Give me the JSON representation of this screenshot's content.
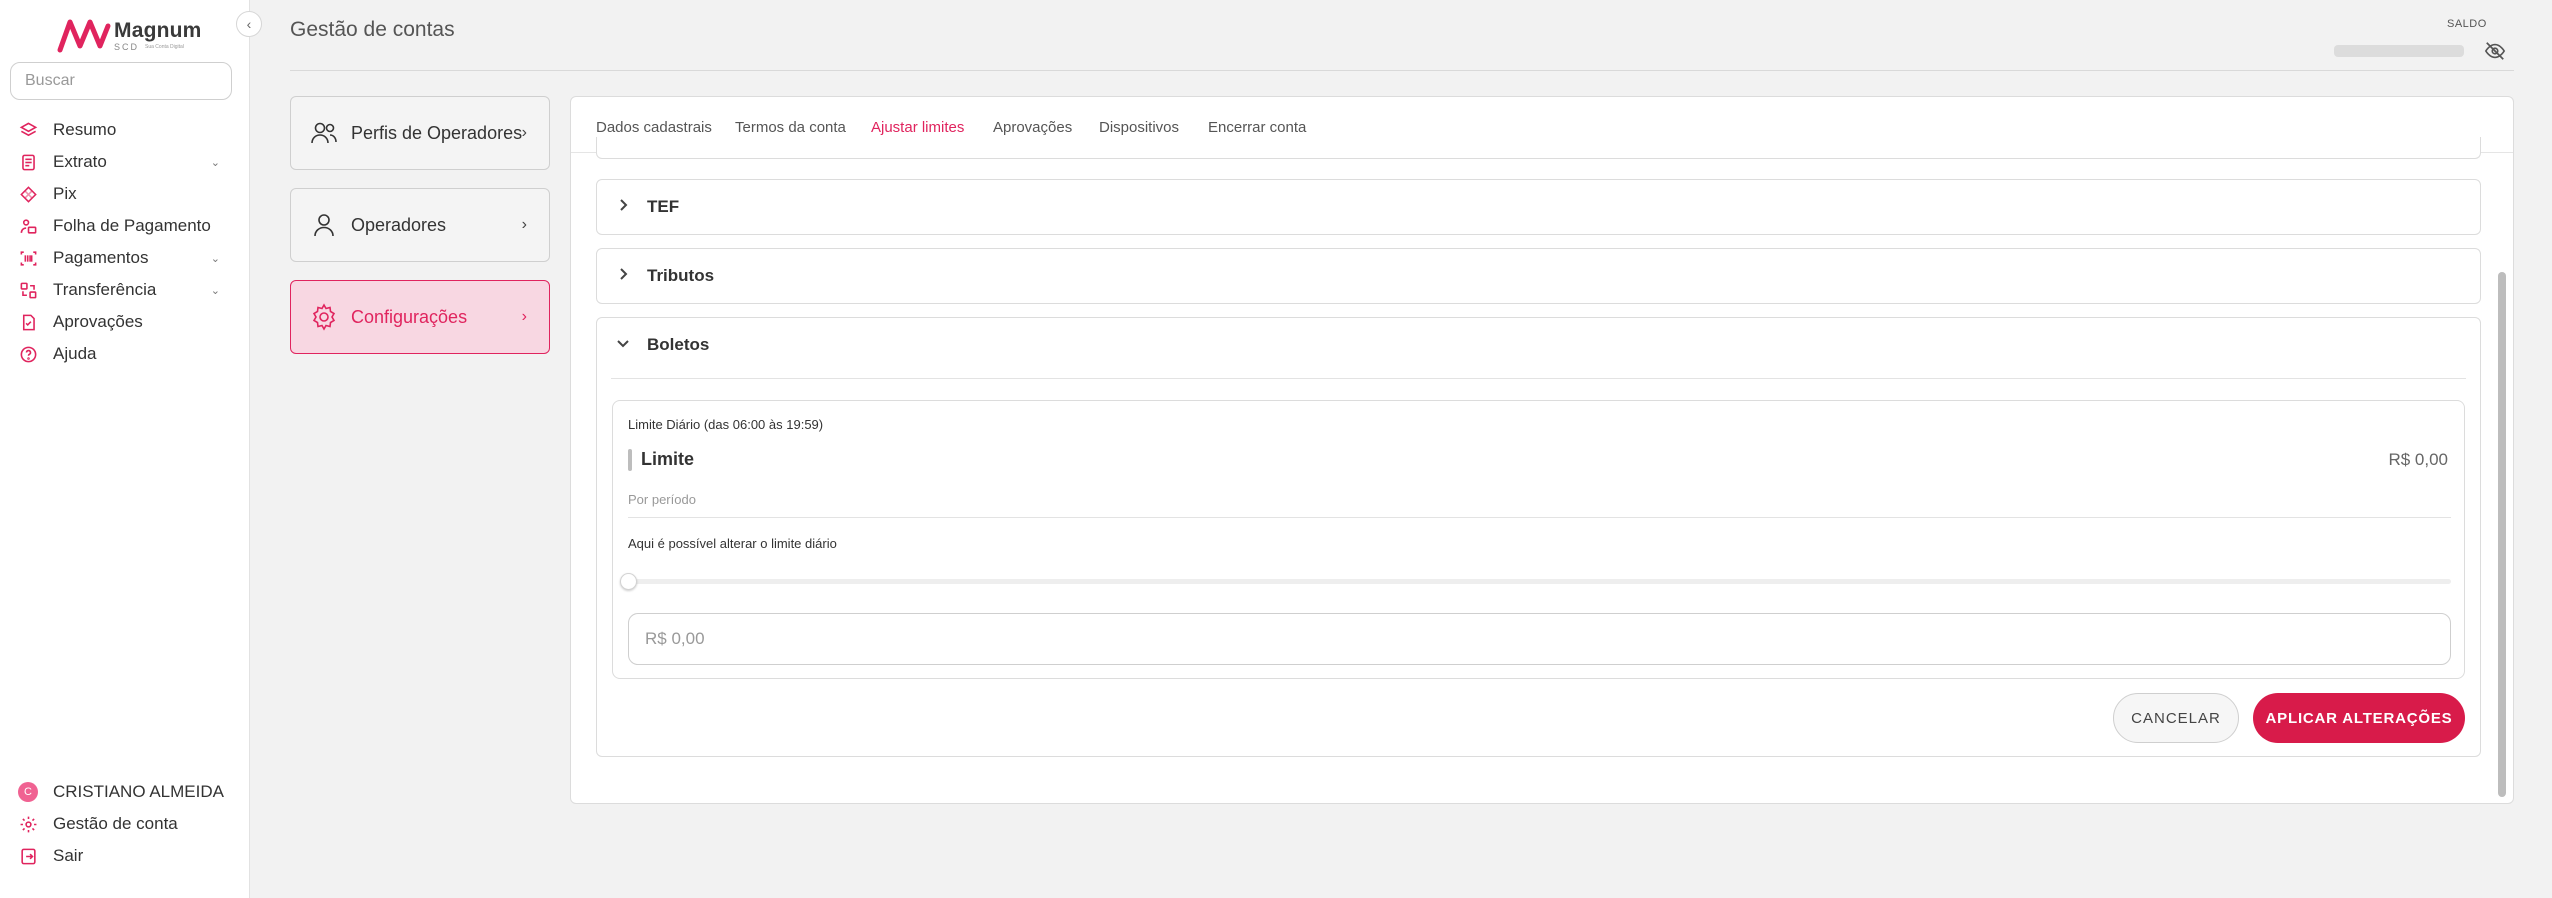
{
  "app": {
    "logo_name": "Magnum",
    "logo_sub": "SCD",
    "logo_tagline": "Sua Conta Digital",
    "accent_color": "#e0245e"
  },
  "sidebar": {
    "search_placeholder": "Buscar",
    "items": [
      {
        "label": "Resumo",
        "icon": "layers-icon",
        "has_submenu": false
      },
      {
        "label": "Extrato",
        "icon": "statement-icon",
        "has_submenu": true
      },
      {
        "label": "Pix",
        "icon": "pix-icon",
        "has_submenu": false
      },
      {
        "label": "Folha de Pagamento",
        "icon": "payroll-icon",
        "has_submenu": false
      },
      {
        "label": "Pagamentos",
        "icon": "barcode-icon",
        "has_submenu": true
      },
      {
        "label": "Transferência",
        "icon": "transfer-icon",
        "has_submenu": true
      },
      {
        "label": "Aprovações",
        "icon": "approval-icon",
        "has_submenu": false
      },
      {
        "label": "Ajuda",
        "icon": "help-icon",
        "has_submenu": false
      }
    ],
    "user": {
      "initial": "C",
      "name": "CRISTIANO ALMEIDA"
    },
    "account_management": "Gestão de conta",
    "logout": "Sair"
  },
  "header": {
    "title": "Gestão de contas",
    "saldo_label": "SALDO"
  },
  "settings_menu": [
    {
      "label": "Perfis de Operadores",
      "icon": "users-icon",
      "active": false
    },
    {
      "label": "Operadores",
      "icon": "user-icon",
      "active": false
    },
    {
      "label": "Configurações",
      "icon": "gear-icon",
      "active": true
    }
  ],
  "tabs": [
    {
      "label": "Dados cadastrais",
      "active": false
    },
    {
      "label": "Termos da conta",
      "active": false
    },
    {
      "label": "Ajustar limites",
      "active": true
    },
    {
      "label": "Aprovações",
      "active": false
    },
    {
      "label": "Dispositivos",
      "active": false
    },
    {
      "label": "Encerrar conta",
      "active": false
    }
  ],
  "limits": {
    "sections": [
      {
        "title": "TEF",
        "expanded": false
      },
      {
        "title": "Tributos",
        "expanded": false
      },
      {
        "title": "Boletos",
        "expanded": true
      }
    ],
    "boletos": {
      "heading": "Limite Diário (das 06:00 às 19:59)",
      "limit_label": "Limite",
      "limit_value": "R$ 0,00",
      "period_label": "Por período",
      "hint": "Aqui é possível alterar o limite diário",
      "slider_value": 0,
      "input_placeholder": "R$ 0,00",
      "cancel_label": "CANCELAR",
      "apply_label": "APLICAR ALTERAÇÕES"
    }
  }
}
